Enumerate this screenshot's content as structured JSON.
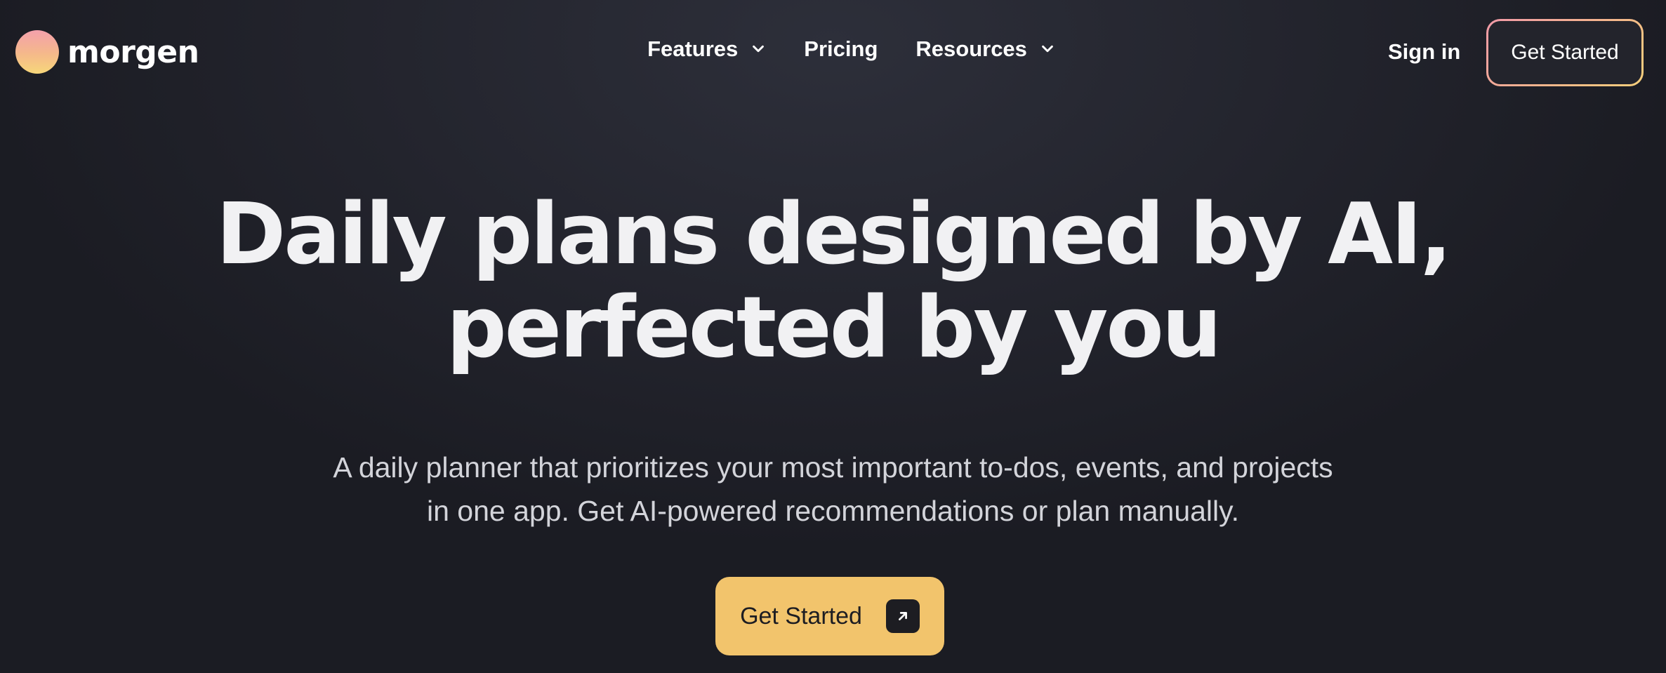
{
  "brand": {
    "name": "morgen",
    "logo_icon": "sunrise-circle-logo",
    "gradient_colors": [
      "#f3a0ac",
      "#f5b98a",
      "#f7d77a"
    ]
  },
  "nav": {
    "items": [
      {
        "label": "Features",
        "has_dropdown": true
      },
      {
        "label": "Pricing",
        "has_dropdown": false
      },
      {
        "label": "Resources",
        "has_dropdown": true
      }
    ]
  },
  "header": {
    "sign_in_label": "Sign in",
    "cta_label": "Get Started"
  },
  "hero": {
    "title_line1": "Daily plans designed by AI,",
    "title_line2": "perfected by you",
    "subtitle_line1": "A daily planner that prioritizes your most important to-dos, events, and projects",
    "subtitle_line2": "in one app. Get AI-powered recommendations or plan manually.",
    "cta_label": "Get Started",
    "cta_icon": "arrow-up-right-icon"
  },
  "colors": {
    "background": "#1b1c23",
    "accent": "#f2c46c",
    "text": "#ffffff",
    "muted_text": "#d3d4da"
  }
}
